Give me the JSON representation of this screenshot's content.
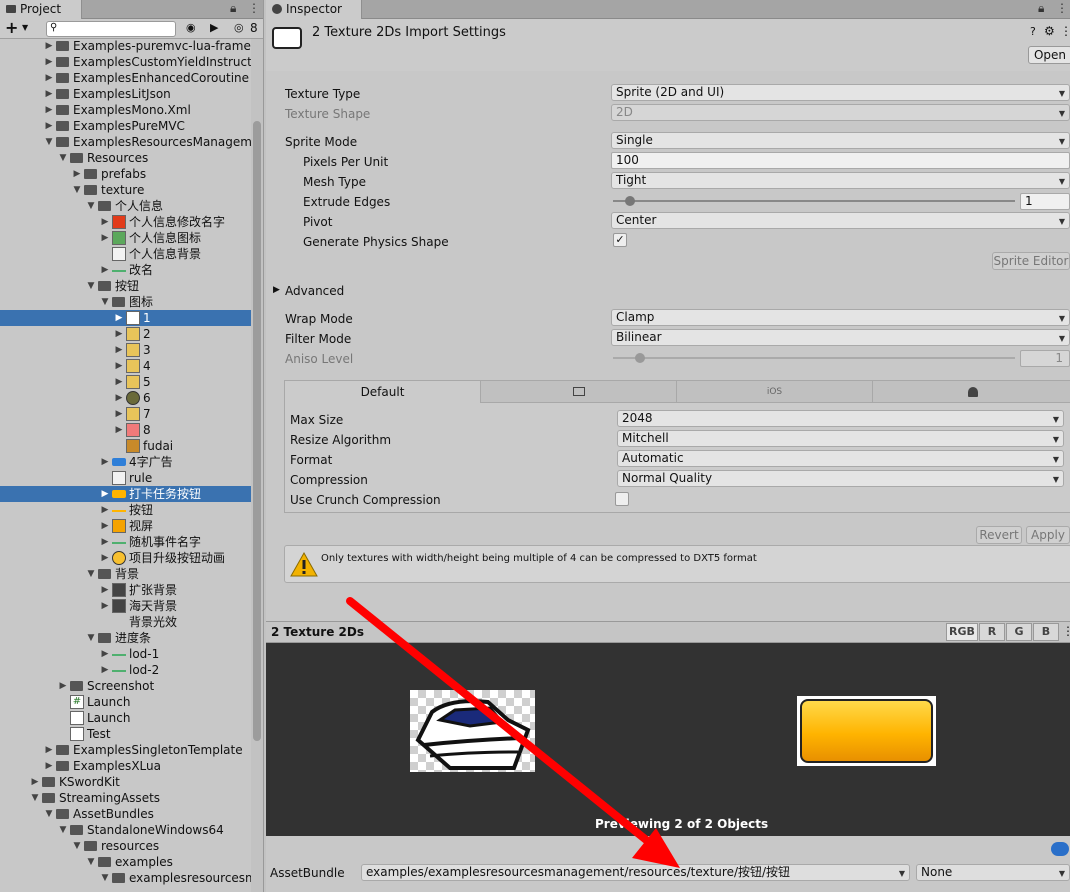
{
  "project_panel": {
    "tab_label": "Project",
    "hidden_count": "8",
    "search": {
      "value": "",
      "placeholder": ""
    },
    "tree": [
      {
        "label": "Examples-puremvc-lua-framewo",
        "depth": 2,
        "kind": "folder",
        "expanded": false
      },
      {
        "label": "ExamplesCustomYieldInstruction",
        "depth": 2,
        "kind": "folder",
        "expanded": false
      },
      {
        "label": "ExamplesEnhancedCoroutine",
        "depth": 2,
        "kind": "folder",
        "expanded": false
      },
      {
        "label": "ExamplesLitJson",
        "depth": 2,
        "kind": "folder",
        "expanded": false
      },
      {
        "label": "ExamplesMono.Xml",
        "depth": 2,
        "kind": "folder",
        "expanded": false
      },
      {
        "label": "ExamplesPureMVC",
        "depth": 2,
        "kind": "folder",
        "expanded": false
      },
      {
        "label": "ExamplesResourcesManagement",
        "depth": 2,
        "kind": "folder",
        "expanded": true
      },
      {
        "label": "Resources",
        "depth": 3,
        "kind": "folder",
        "expanded": true
      },
      {
        "label": "prefabs",
        "depth": 4,
        "kind": "folder",
        "expanded": false
      },
      {
        "label": "texture",
        "depth": 4,
        "kind": "folder",
        "expanded": true
      },
      {
        "label": "个人信息",
        "depth": 5,
        "kind": "folder",
        "expanded": true
      },
      {
        "label": "个人信息修改名字",
        "depth": 6,
        "kind": "sprite-pencil",
        "expanded": false
      },
      {
        "label": "个人信息图标",
        "depth": 6,
        "kind": "sprite-card",
        "expanded": false
      },
      {
        "label": "个人信息背景",
        "depth": 6,
        "kind": "sprite-white",
        "expanded": null
      },
      {
        "label": "改名",
        "depth": 6,
        "kind": "sprite-line",
        "expanded": false
      },
      {
        "label": "按钮",
        "depth": 5,
        "kind": "folder",
        "expanded": true
      },
      {
        "label": "图标",
        "depth": 6,
        "kind": "folder",
        "expanded": true
      },
      {
        "label": "1",
        "depth": 7,
        "kind": "sprite-boat",
        "expanded": false,
        "selected": true
      },
      {
        "label": "2",
        "depth": 7,
        "kind": "sprite-icon",
        "expanded": false
      },
      {
        "label": "3",
        "depth": 7,
        "kind": "sprite-icon",
        "expanded": false
      },
      {
        "label": "4",
        "depth": 7,
        "kind": "sprite-icon",
        "expanded": false
      },
      {
        "label": "5",
        "depth": 7,
        "kind": "sprite-icon",
        "expanded": false
      },
      {
        "label": "6",
        "depth": 7,
        "kind": "sprite-clock",
        "expanded": false
      },
      {
        "label": "7",
        "depth": 7,
        "kind": "sprite-icon",
        "expanded": false
      },
      {
        "label": "8",
        "depth": 7,
        "kind": "sprite-pig",
        "expanded": false
      },
      {
        "label": "fudai",
        "depth": 7,
        "kind": "sprite-bag",
        "expanded": null
      },
      {
        "label": "4字广告",
        "depth": 6,
        "kind": "sprite-bar",
        "expanded": false
      },
      {
        "label": "rule",
        "depth": 6,
        "kind": "sprite-white",
        "expanded": null
      },
      {
        "label": "打卡任务按钮",
        "depth": 6,
        "kind": "sprite-yellow",
        "expanded": false,
        "selected": true
      },
      {
        "label": "按钮",
        "depth": 6,
        "kind": "sprite-yellowline",
        "expanded": false
      },
      {
        "label": "视屏",
        "depth": 6,
        "kind": "sprite-play",
        "expanded": false
      },
      {
        "label": "随机事件名字",
        "depth": 6,
        "kind": "sprite-line",
        "expanded": false
      },
      {
        "label": "项目升级按钮动画",
        "depth": 6,
        "kind": "sprite-round",
        "expanded": false
      },
      {
        "label": "背景",
        "depth": 5,
        "kind": "folder",
        "expanded": true
      },
      {
        "label": "扩张背景",
        "depth": 6,
        "kind": "sprite-dark",
        "expanded": false
      },
      {
        "label": "海天背景",
        "depth": 6,
        "kind": "sprite-dark",
        "expanded": false
      },
      {
        "label": "背景光效",
        "depth": 6,
        "kind": "sprite-none",
        "expanded": null
      },
      {
        "label": "进度条",
        "depth": 5,
        "kind": "folder",
        "expanded": true
      },
      {
        "label": "lod-1",
        "depth": 6,
        "kind": "sprite-line",
        "expanded": false
      },
      {
        "label": "lod-2",
        "depth": 6,
        "kind": "sprite-line",
        "expanded": false
      },
      {
        "label": "Screenshot",
        "depth": 3,
        "kind": "folder",
        "expanded": false
      },
      {
        "label": "Launch",
        "depth": 3,
        "kind": "script",
        "expanded": null
      },
      {
        "label": "Launch",
        "depth": 3,
        "kind": "scene",
        "expanded": null
      },
      {
        "label": "Test",
        "depth": 3,
        "kind": "unity",
        "expanded": null
      },
      {
        "label": "ExamplesSingletonTemplate",
        "depth": 2,
        "kind": "folder",
        "expanded": false
      },
      {
        "label": "ExamplesXLua",
        "depth": 2,
        "kind": "folder",
        "expanded": false
      },
      {
        "label": "KSwordKit",
        "depth": 1,
        "kind": "folder",
        "expanded": false
      },
      {
        "label": "StreamingAssets",
        "depth": 1,
        "kind": "folder",
        "expanded": true
      },
      {
        "label": "AssetBundles",
        "depth": 2,
        "kind": "folder",
        "expanded": true
      },
      {
        "label": "StandaloneWindows64",
        "depth": 3,
        "kind": "folder",
        "expanded": true
      },
      {
        "label": "resources",
        "depth": 4,
        "kind": "folder",
        "expanded": true
      },
      {
        "label": "examples",
        "depth": 5,
        "kind": "folder",
        "expanded": true
      },
      {
        "label": "examplesresourcesman",
        "depth": 6,
        "kind": "folder",
        "expanded": true
      }
    ]
  },
  "inspector": {
    "tab_label": "Inspector",
    "title": "2 Texture 2Ds Import Settings",
    "open_button": "Open",
    "texture_type": {
      "label": "Texture Type",
      "value": "Sprite (2D and UI)"
    },
    "texture_shape": {
      "label": "Texture Shape",
      "value": "2D"
    },
    "sprite_mode": {
      "label": "Sprite Mode",
      "value": "Single"
    },
    "pixels_per_unit": {
      "label": "Pixels Per Unit",
      "value": "100"
    },
    "mesh_type": {
      "label": "Mesh Type",
      "value": "Tight"
    },
    "extrude_edges": {
      "label": "Extrude Edges",
      "value": "1"
    },
    "pivot": {
      "label": "Pivot",
      "value": "Center"
    },
    "generate_physics_shape": {
      "label": "Generate Physics Shape",
      "checked": true
    },
    "sprite_editor_button": "Sprite Editor",
    "advanced_label": "Advanced",
    "wrap_mode": {
      "label": "Wrap Mode",
      "value": "Clamp"
    },
    "filter_mode": {
      "label": "Filter Mode",
      "value": "Bilinear"
    },
    "aniso_level": {
      "label": "Aniso Level",
      "value": "1"
    },
    "platform_tabs": [
      "Default",
      "",
      "iOS",
      ""
    ],
    "max_size": {
      "label": "Max Size",
      "value": "2048"
    },
    "resize_algorithm": {
      "label": "Resize Algorithm",
      "value": "Mitchell"
    },
    "format": {
      "label": "Format",
      "value": "Automatic"
    },
    "compression": {
      "label": "Compression",
      "value": "Normal Quality"
    },
    "use_crunch": {
      "label": "Use Crunch Compression",
      "checked": false
    },
    "revert_button": "Revert",
    "apply_button": "Apply",
    "warning_text": "Only textures with width/height being multiple of 4 can be compressed to DXT5 format",
    "preview_title": "2 Texture 2Ds",
    "channels": [
      "RGB",
      "R",
      "G",
      "B"
    ],
    "preview_caption": "Previewing 2 of 2 Objects",
    "assetbundle_label": "AssetBundle",
    "assetbundle_name": "examples/examplesresourcesmanagement/resources/texture/按钮/按钮",
    "assetbundle_variant": "None"
  },
  "colors": {
    "selection": "#3a72b0",
    "arrow": "#ff0000",
    "preview_bg": "#323232",
    "button_yellow": "#ffb400"
  }
}
